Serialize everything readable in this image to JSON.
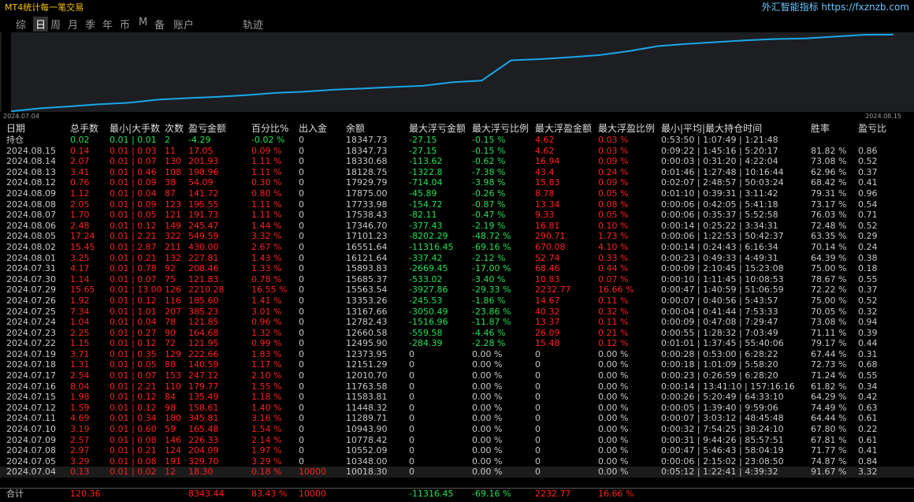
{
  "app_title": "MT4统计每一笔交易",
  "brand": "外汇智能指标 https://fxznzb.com",
  "tabs": [
    "综",
    "日",
    "周",
    "月",
    "季",
    "年",
    "币",
    "M",
    "备",
    "账户",
    "轨迹"
  ],
  "active_tab": "日",
  "chart_data": {
    "type": "line",
    "x_start_label": "2024.07.04",
    "x_end_label": "2024.08.15",
    "x": [
      "2024.07.04",
      "2024.07.05",
      "2024.07.08",
      "2024.07.09",
      "2024.07.10",
      "2024.07.11",
      "2024.07.12",
      "2024.07.15",
      "2024.07.16",
      "2024.07.17",
      "2024.07.18",
      "2024.07.19",
      "2024.07.22",
      "2024.07.23",
      "2024.07.24",
      "2024.07.25",
      "2024.07.26",
      "2024.07.29",
      "2024.07.30",
      "2024.07.31",
      "2024.08.01",
      "2024.08.02",
      "2024.08.05",
      "2024.08.06",
      "2024.08.07",
      "2024.08.08",
      "2024.08.09",
      "2024.08.12",
      "2024.08.13",
      "2024.08.14",
      "2024.08.15"
    ],
    "values": [
      10018.3,
      10348.0,
      10552.09,
      10778.42,
      10943.9,
      11289.71,
      11448.32,
      11583.81,
      11763.58,
      12010.7,
      12151.29,
      12373.95,
      12495.9,
      12660.58,
      12782.43,
      13167.66,
      13353.26,
      15563.54,
      15685.37,
      15893.83,
      16121.64,
      16551.64,
      17101.23,
      17346.7,
      17538.43,
      17733.98,
      17875.0,
      17929.79,
      18128.75,
      18330.68,
      18347.73
    ],
    "ylim": [
      9950,
      18600
    ],
    "line_color": "#1aa7e8"
  },
  "columns": [
    "日期",
    "总手数",
    "最小|大手数",
    "次数",
    "盈亏金额",
    "百分比%",
    "出入金",
    "余额",
    "最大浮亏金额",
    "最大浮亏比例",
    "最大浮盈金额",
    "最大浮盈比例",
    "最小|平均|最大持仓时间",
    "胜率",
    "盈亏比"
  ],
  "holding_row": {
    "date": "持仓",
    "lots": "0.02",
    "minmax": "0.01 | 0.01",
    "count": "2",
    "pl": "-4.29",
    "pct": "-0.02 %",
    "io": "0",
    "balance": "18347.73",
    "mfl": "-27.15",
    "mflp": "-0.15 %",
    "mfp": "4.62",
    "mfpp": "0.03 %",
    "time": "0:53:50 | 1:07:49 | 1:21:48",
    "win": "",
    "ratio": ""
  },
  "rows": [
    {
      "date": "2024.08.15",
      "lots": "0.14",
      "minmax": "0.01 | 0.03",
      "count": "11",
      "pl": "17.05",
      "pct": "0.09 %",
      "io": "0",
      "balance": "18347.73",
      "mfl": "-27.15",
      "mflp": "-0.15 %",
      "mfp": "4.62",
      "mfpp": "0.03 %",
      "time": "0:09:22 | 1:45:16 | 5:20:17",
      "win": "81.82 %",
      "ratio": "0.86"
    },
    {
      "date": "2024.08.14",
      "lots": "2.07",
      "minmax": "0.01 | 0.07",
      "count": "130",
      "pl": "201.93",
      "pct": "1.11 %",
      "io": "0",
      "balance": "18330.68",
      "mfl": "-113.62",
      "mflp": "-0.62 %",
      "mfp": "16.94",
      "mfpp": "0.09 %",
      "time": "0:00:03 | 0:31:20 | 4:22:04",
      "win": "73.08 %",
      "ratio": "0.52"
    },
    {
      "date": "2024.08.13",
      "lots": "3.41",
      "minmax": "0.01 | 0.46",
      "count": "108",
      "pl": "198.96",
      "pct": "1.11 %",
      "io": "0",
      "balance": "18128.75",
      "mfl": "-1322.8",
      "mflp": "-7.38 %",
      "mfp": "43.4",
      "mfpp": "0.24 %",
      "time": "0:01:46 | 1:27:48 | 10:16:44",
      "win": "62.96 %",
      "ratio": "0.37"
    },
    {
      "date": "2024.08.12",
      "lots": "0.76",
      "minmax": "0.01 | 0.09",
      "count": "38",
      "pl": "54.09",
      "pct": "0.30 %",
      "io": "0",
      "balance": "17929.79",
      "mfl": "-714.04",
      "mflp": "-3.98 %",
      "mfp": "15.83",
      "mfpp": "0.09 %",
      "time": "0:02:07 | 2:48:57 | 50:03:24",
      "win": "68.42 %",
      "ratio": "0.41"
    },
    {
      "date": "2024.08.09",
      "lots": "1.12",
      "minmax": "0.01 | 0.04",
      "count": "87",
      "pl": "141.72",
      "pct": "0.80 %",
      "io": "0",
      "balance": "17875.00",
      "mfl": "-45.89",
      "mflp": "-0.26 %",
      "mfp": "8.78",
      "mfpp": "0.05 %",
      "time": "0:01:10 | 0:39:31 | 3:11:42",
      "win": "79.31 %",
      "ratio": "0.96"
    },
    {
      "date": "2024.08.08",
      "lots": "2.05",
      "minmax": "0.01 | 0.09",
      "count": "123",
      "pl": "195.55",
      "pct": "1.11 %",
      "io": "0",
      "balance": "17733.98",
      "mfl": "-154.72",
      "mflp": "-0.87 %",
      "mfp": "13.34",
      "mfpp": "0.08 %",
      "time": "0:00:06 | 0:42:05 | 5:41:18",
      "win": "73.17 %",
      "ratio": "0.54"
    },
    {
      "date": "2024.08.07",
      "lots": "1.70",
      "minmax": "0.01 | 0.05",
      "count": "121",
      "pl": "191.73",
      "pct": "1.11 %",
      "io": "0",
      "balance": "17538.43",
      "mfl": "-82.11",
      "mflp": "-0.47 %",
      "mfp": "9.33",
      "mfpp": "0.05 %",
      "time": "0:00:06 | 0:35:37 | 5:52:58",
      "win": "76.03 %",
      "ratio": "0.71"
    },
    {
      "date": "2024.08.06",
      "lots": "2.48",
      "minmax": "0.01 | 0.12",
      "count": "149",
      "pl": "245.47",
      "pct": "1.44 %",
      "io": "0",
      "balance": "17346.70",
      "mfl": "-377.43",
      "mflp": "-2.19 %",
      "mfp": "16.81",
      "mfpp": "0.10 %",
      "time": "0:00:14 | 0:25:22 | 3:34:31",
      "win": "72.48 %",
      "ratio": "0.52"
    },
    {
      "date": "2024.08.05",
      "lots": "17.24",
      "minmax": "0.01 | 2.21",
      "count": "322",
      "pl": "549.59",
      "pct": "3.32 %",
      "io": "0",
      "balance": "17101.23",
      "mfl": "-8202.29",
      "mflp": "-48.72 %",
      "mfp": "290.71",
      "mfpp": "1.73 %",
      "time": "0:00:06 | 1:22:53 | 50:42:37",
      "win": "63.35 %",
      "ratio": "0.29"
    },
    {
      "date": "2024.08.02",
      "lots": "15.45",
      "minmax": "0.01 | 2.87",
      "count": "211",
      "pl": "430.00",
      "pct": "2.67 %",
      "io": "0",
      "balance": "16551.64",
      "mfl": "-11316.45",
      "mflp": "-69.16 %",
      "mfp": "670.08",
      "mfpp": "4.10 %",
      "time": "0:00:14 | 0:24:43 | 6:16:34",
      "win": "70.14 %",
      "ratio": "0.24"
    },
    {
      "date": "2024.08.01",
      "lots": "3.25",
      "minmax": "0.01 | 0.21",
      "count": "132",
      "pl": "227.81",
      "pct": "1.43 %",
      "io": "0",
      "balance": "16121.64",
      "mfl": "-337.42",
      "mflp": "-2.12 %",
      "mfp": "52.74",
      "mfpp": "0.33 %",
      "time": "0:00:23 | 0:49:33 | 4:49:31",
      "win": "64.39 %",
      "ratio": "0.38"
    },
    {
      "date": "2024.07.31",
      "lots": "4.17",
      "minmax": "0.01 | 0.78",
      "count": "92",
      "pl": "208.46",
      "pct": "1.33 %",
      "io": "0",
      "balance": "15893.83",
      "mfl": "-2669.45",
      "mflp": "-17.00 %",
      "mfp": "68.46",
      "mfpp": "0.44 %",
      "time": "0:00:09 | 2:10:45 | 15:23:08",
      "win": "75.00 %",
      "ratio": "0.18"
    },
    {
      "date": "2024.07.30",
      "lots": "1.14",
      "minmax": "0.01 | 0.07",
      "count": "75",
      "pl": "121.83",
      "pct": "0.78 %",
      "io": "0",
      "balance": "15685.37",
      "mfl": "-533.02",
      "mflp": "-3.40 %",
      "mfp": "10.83",
      "mfpp": "0.07 %",
      "time": "0:00:10 | 1:11:45 | 10:08:53",
      "win": "78.67 %",
      "ratio": "0.55"
    },
    {
      "date": "2024.07.29",
      "lots": "15.65",
      "minmax": "0.01 | 13.00",
      "count": "126",
      "pl": "2210.28",
      "pct": "16.55 %",
      "io": "0",
      "balance": "15563.54",
      "mfl": "-3927.86",
      "mflp": "-29.33 %",
      "mfp": "2232.77",
      "mfpp": "16.66 %",
      "time": "0:00:47 | 1:40:59 | 51:06:59",
      "win": "72.22 %",
      "ratio": "0.37"
    },
    {
      "date": "2024.07.26",
      "lots": "1.92",
      "minmax": "0.01 | 0.12",
      "count": "116",
      "pl": "185.60",
      "pct": "1.41 %",
      "io": "0",
      "balance": "13353.26",
      "mfl": "-245.53",
      "mflp": "-1.86 %",
      "mfp": "14.67",
      "mfpp": "0.11 %",
      "time": "0:00:07 | 0:40:56 | 5:43:57",
      "win": "75.00 %",
      "ratio": "0.52"
    },
    {
      "date": "2024.07.25",
      "lots": "7.34",
      "minmax": "0.01 | 1.01",
      "count": "207",
      "pl": "385.23",
      "pct": "3.01 %",
      "io": "0",
      "balance": "13167.66",
      "mfl": "-3050.49",
      "mflp": "-23.86 %",
      "mfp": "40.32",
      "mfpp": "0.32 %",
      "time": "0:00:04 | 0:41:44 | 7:53:33",
      "win": "70.05 %",
      "ratio": "0.32"
    },
    {
      "date": "2024.07.24",
      "lots": "1.04",
      "minmax": "0.01 | 0.04",
      "count": "78",
      "pl": "121.85",
      "pct": "0.96 %",
      "io": "0",
      "balance": "12782.43",
      "mfl": "-1516.96",
      "mflp": "-11.87 %",
      "mfp": "13.37",
      "mfpp": "0.11 %",
      "time": "0:00:09 | 0:47:08 | 7:29:47",
      "win": "73.08 %",
      "ratio": "0.94"
    },
    {
      "date": "2024.07.23",
      "lots": "2.25",
      "minmax": "0.01 | 0.27",
      "count": "90",
      "pl": "164.68",
      "pct": "1.32 %",
      "io": "0",
      "balance": "12660.58",
      "mfl": "-559.58",
      "mflp": "-4.46 %",
      "mfp": "26.09",
      "mfpp": "0.21 %",
      "time": "0:00:55 | 1:28:32 | 7:03:49",
      "win": "71.11 %",
      "ratio": "0.39"
    },
    {
      "date": "2024.07.22",
      "lots": "1.15",
      "minmax": "0.01 | 0.12",
      "count": "72",
      "pl": "121.95",
      "pct": "0.99 %",
      "io": "0",
      "balance": "12495.90",
      "mfl": "-284.39",
      "mflp": "-2.28 %",
      "mfp": "15.48",
      "mfpp": "0.12 %",
      "time": "0:01:01 | 1:37:45 | 55:40:06",
      "win": "79.17 %",
      "ratio": "0.44"
    },
    {
      "date": "2024.07.19",
      "lots": "3.71",
      "minmax": "0.01 | 0.35",
      "count": "129",
      "pl": "222.66",
      "pct": "1.83 %",
      "io": "0",
      "balance": "12373.95",
      "mfl": "0",
      "mflp": "0.00 %",
      "mfp": "0",
      "mfpp": "0.00 %",
      "time": "0:00:28 | 0:53:00 | 6:28:22",
      "win": "67.44 %",
      "ratio": "0.31"
    },
    {
      "date": "2024.07.18",
      "lots": "1.31",
      "minmax": "0.01 | 0.05",
      "count": "88",
      "pl": "140.59",
      "pct": "1.17 %",
      "io": "0",
      "balance": "12151.29",
      "mfl": "0",
      "mflp": "0.00 %",
      "mfp": "0",
      "mfpp": "0.00 %",
      "time": "0:00:18 | 1:01:09 | 5:58:20",
      "win": "72.73 %",
      "ratio": "0.68"
    },
    {
      "date": "2024.07.17",
      "lots": "2.54",
      "minmax": "0.01 | 0.07",
      "count": "153",
      "pl": "247.12",
      "pct": "2.10 %",
      "io": "0",
      "balance": "12010.70",
      "mfl": "0",
      "mflp": "0.00 %",
      "mfp": "0",
      "mfpp": "0.00 %",
      "time": "0:00:23 | 0:26:59 | 6:28:20",
      "win": "71.24 %",
      "ratio": "0.55"
    },
    {
      "date": "2024.07.16",
      "lots": "8.04",
      "minmax": "0.01 | 2.21",
      "count": "110",
      "pl": "179.77",
      "pct": "1.55 %",
      "io": "0",
      "balance": "11763.58",
      "mfl": "0",
      "mflp": "0.00 %",
      "mfp": "0",
      "mfpp": "0.00 %",
      "time": "0:00:14 | 13:41:10 | 157:16:16",
      "win": "61.82 %",
      "ratio": "0.34"
    },
    {
      "date": "2024.07.15",
      "lots": "1.98",
      "minmax": "0.01 | 0.12",
      "count": "84",
      "pl": "135.49",
      "pct": "1.18 %",
      "io": "0",
      "balance": "11583.81",
      "mfl": "0",
      "mflp": "0.00 %",
      "mfp": "0",
      "mfpp": "0.00 %",
      "time": "0:00:26 | 5:20:49 | 64:33:10",
      "win": "64.29 %",
      "ratio": "0.42"
    },
    {
      "date": "2024.07.12",
      "lots": "1.59",
      "minmax": "0.01 | 0.12",
      "count": "98",
      "pl": "158.61",
      "pct": "1.40 %",
      "io": "0",
      "balance": "11448.32",
      "mfl": "0",
      "mflp": "0.00 %",
      "mfp": "0",
      "mfpp": "0.00 %",
      "time": "0:00:05 | 1:39:40 | 9:59:06",
      "win": "74.49 %",
      "ratio": "0.63"
    },
    {
      "date": "2024.07.11",
      "lots": "4.69",
      "minmax": "0.01 | 0.34",
      "count": "180",
      "pl": "345.81",
      "pct": "3.16 %",
      "io": "0",
      "balance": "11289.71",
      "mfl": "0",
      "mflp": "0.00 %",
      "mfp": "0",
      "mfpp": "0.00 %",
      "time": "0:00:07 | 3:03:12 | 48:45:48",
      "win": "64.44 %",
      "ratio": "0.61"
    },
    {
      "date": "2024.07.10",
      "lots": "3.19",
      "minmax": "0.01 | 0.60",
      "count": "59",
      "pl": "165.48",
      "pct": "1.54 %",
      "io": "0",
      "balance": "10943.90",
      "mfl": "0",
      "mflp": "0.00 %",
      "mfp": "0",
      "mfpp": "0.00 %",
      "time": "0:00:32 | 7:54:25 | 38:24:10",
      "win": "67.80 %",
      "ratio": "0.22"
    },
    {
      "date": "2024.07.09",
      "lots": "2.57",
      "minmax": "0.01 | 0.08",
      "count": "146",
      "pl": "226.33",
      "pct": "2.14 %",
      "io": "0",
      "balance": "10778.42",
      "mfl": "0",
      "mflp": "0.00 %",
      "mfp": "0",
      "mfpp": "0.00 %",
      "time": "0:00:31 | 9:44:26 | 85:57:51",
      "win": "67.81 %",
      "ratio": "0.61"
    },
    {
      "date": "2024.07.08",
      "lots": "2.97",
      "minmax": "0.01 | 0.21",
      "count": "124",
      "pl": "204.09",
      "pct": "1.97 %",
      "io": "0",
      "balance": "10552.09",
      "mfl": "0",
      "mflp": "0.00 %",
      "mfp": "0",
      "mfpp": "0.00 %",
      "time": "0:00:47 | 5:46:43 | 58:04:19",
      "win": "71.77 %",
      "ratio": "0.41"
    },
    {
      "date": "2024.07.05",
      "lots": "3.29",
      "minmax": "0.01 | 0.08",
      "count": "191",
      "pl": "329.70",
      "pct": "3.29 %",
      "io": "0",
      "balance": "10348.00",
      "mfl": "0",
      "mflp": "0.00 %",
      "mfp": "0",
      "mfpp": "0.00 %",
      "time": "0:00:06 | 2:15:02 | 23:08:50",
      "win": "74.87 %",
      "ratio": "0.84"
    },
    {
      "date": "2024.07.04",
      "lots": "0.13",
      "minmax": "0.01 | 0.02",
      "count": "12",
      "pl": "18.30",
      "pct": "0.18 %",
      "io": "10000",
      "balance": "10018.30",
      "mfl": "0",
      "mflp": "0.00 %",
      "mfp": "0",
      "mfpp": "0.00 %",
      "time": "0:05:12 | 1:22:41 | 4:39:32",
      "win": "91.67 %",
      "ratio": "3.32"
    }
  ],
  "total_row": {
    "label": "合计",
    "lots": "120.36",
    "pl": "8343.44",
    "pct": "83.43 %",
    "io": "10000",
    "mfl": "-11316.45",
    "mflp": "-69.16 %",
    "mfp": "2232.77",
    "mfpp": "16.66 %"
  },
  "colors": {
    "title": "#f5c400",
    "brand": "#69c7ff",
    "loss": "#22e055",
    "profit": "#ff2020",
    "chart_bg": "#1c1e22"
  }
}
